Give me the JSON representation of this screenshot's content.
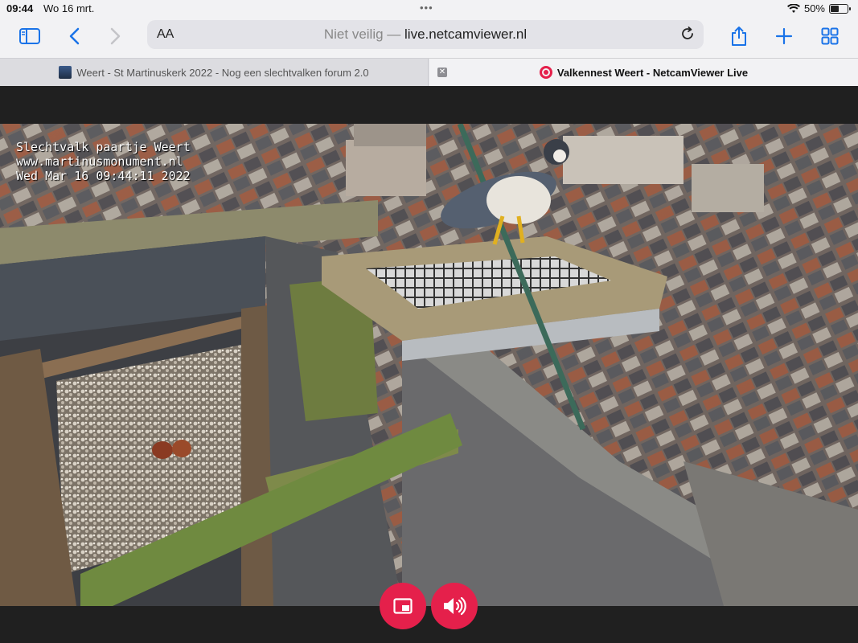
{
  "status_bar": {
    "time": "09:44",
    "date": "Wo 16 mrt.",
    "battery": "50%",
    "battery_level": 0.5
  },
  "toolbar": {
    "text_size_label": "AA",
    "address_insecure": "Niet veilig —",
    "address_host": "live.netcamviewer.nl",
    "icons": [
      "sidebar-icon",
      "back-icon",
      "forward-icon",
      "reload-icon",
      "share-icon",
      "new-tab-icon",
      "tabs-overview-icon"
    ]
  },
  "tabs": [
    {
      "title": "Weert - St Martinuskerk 2022 - Nog een slechtvalken forum 2.0",
      "active": false
    },
    {
      "title": "Valkennest Weert - NetcamViewer Live",
      "active": true
    }
  ],
  "video": {
    "overlay_lines": [
      "Slechtvalk paartje Weert",
      "www.martinusmonument.nl",
      "Wed Mar 16 09:44:11 2022"
    ]
  },
  "controls": [
    "picture-in-picture-icon",
    "volume-icon"
  ],
  "colors": {
    "accent": "#1a73e8",
    "brand": "#e5204b"
  }
}
